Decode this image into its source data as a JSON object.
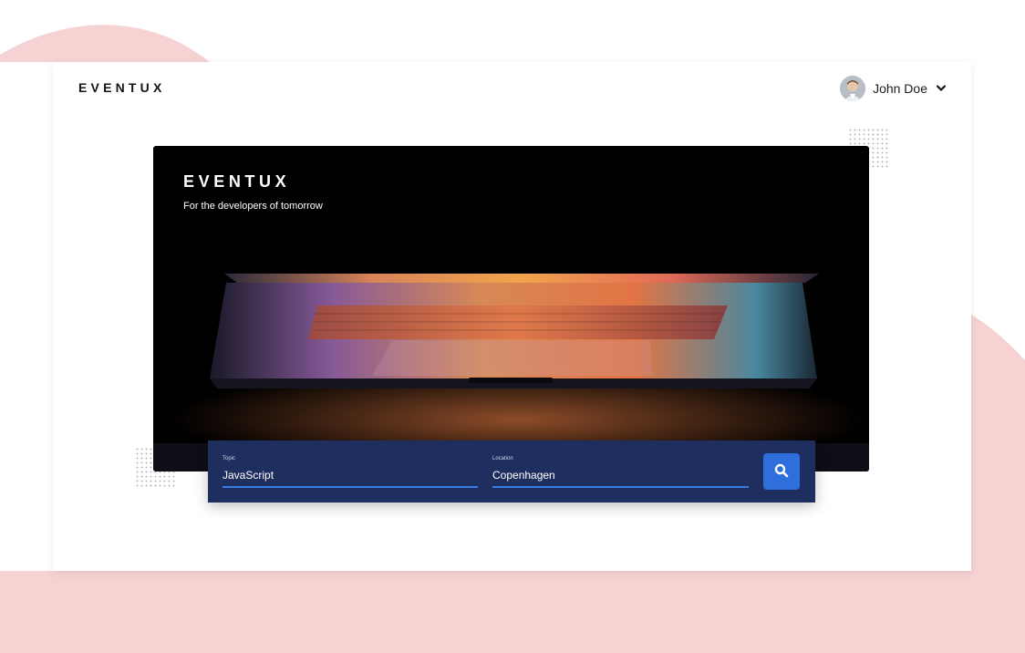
{
  "header": {
    "brand": "EVENTUX",
    "user_name": "John Doe",
    "user_menu_icon": "chevron-down-icon"
  },
  "hero": {
    "title": "EVENTUX",
    "subtitle": "For the developers of tomorrow"
  },
  "search": {
    "topic_label": "Topic",
    "topic_value": "JavaScript",
    "location_label": "Location",
    "location_value": "Copenhagen",
    "button_icon": "search-icon"
  },
  "colors": {
    "background_blob": "#f6d2d2",
    "search_bar": "#1e2e5f",
    "accent": "#2f6fdc",
    "input_underline": "#3a7be0"
  }
}
